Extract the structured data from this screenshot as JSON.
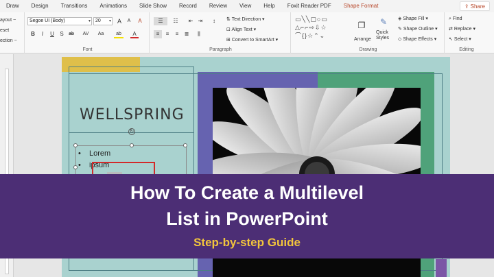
{
  "tabs": [
    "Draw",
    "Design",
    "Transitions",
    "Animations",
    "Slide Show",
    "Record",
    "Review",
    "View",
    "Help",
    "Foxit Reader PDF",
    "Shape Format"
  ],
  "active_tab_index": 10,
  "share_label": "Share",
  "ribbon": {
    "left_cut": {
      "layout": "ayout ~",
      "reset": "eset",
      "section": "ection ~"
    },
    "font": {
      "group_label": "Font",
      "family": "Segoe UI (Body)",
      "size": "20",
      "grow": "A",
      "shrink": "A",
      "clear": "A",
      "bold": "B",
      "italic": "I",
      "underline": "U",
      "strike": "S",
      "shadow": "ab",
      "spacing": "AV",
      "case": "Aa",
      "highlight": "ab",
      "color": "A"
    },
    "paragraph": {
      "group_label": "Paragraph",
      "text_direction": "Text Direction",
      "align_text": "Align Text",
      "convert_smartart": "Convert to SmartArt"
    },
    "drawing": {
      "group_label": "Drawing",
      "arrange": "Arrange",
      "quick_styles": "Quick Styles",
      "shape_fill": "Shape Fill",
      "shape_outline": "Shape Outline",
      "shape_effects": "Shape Effects"
    },
    "editing": {
      "group_label": "Editing",
      "find": "Find",
      "replace": "Replace",
      "select": "Select"
    }
  },
  "slide": {
    "title": "WELLSPRING",
    "bullets": [
      "Lorem",
      "ipsum"
    ]
  },
  "banner": {
    "line1": "How To Create a Multilevel",
    "line2": "List in PowerPoint",
    "subtitle": "Step-by-step Guide"
  },
  "colors": {
    "slide_bg": "#a9d2cf",
    "purple": "#6663b0",
    "green": "#4fa27a",
    "yellow": "#dfbf4a",
    "banner_bg": "#4c2e75",
    "banner_sub": "#f2c53c",
    "accent": "#b7472a"
  }
}
